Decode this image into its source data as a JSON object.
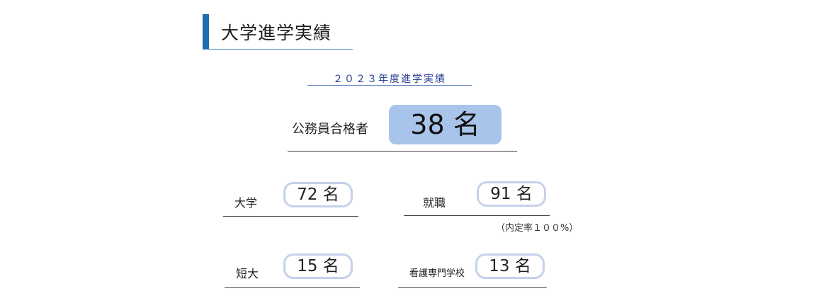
{
  "section": {
    "title": "大学進学実績"
  },
  "subtitle": "２０２３年度進学実績",
  "headline": {
    "label": "公務員合格者",
    "value": "38 名"
  },
  "results": {
    "university": {
      "label": "大学",
      "value": "72 名"
    },
    "employment": {
      "label": "就職",
      "value": "91 名",
      "note": "（内定率１００%）"
    },
    "junior_college": {
      "label": "短大",
      "value": "15 名"
    },
    "nursing_vocational": {
      "label": "看護専門学校",
      "value": "13 名"
    }
  },
  "colors": {
    "accent": "#1f6bb3",
    "highlight_box": "#a8c4ea",
    "pill_border": "#c6d1ea",
    "subtitle_text": "#2a3f8f"
  }
}
